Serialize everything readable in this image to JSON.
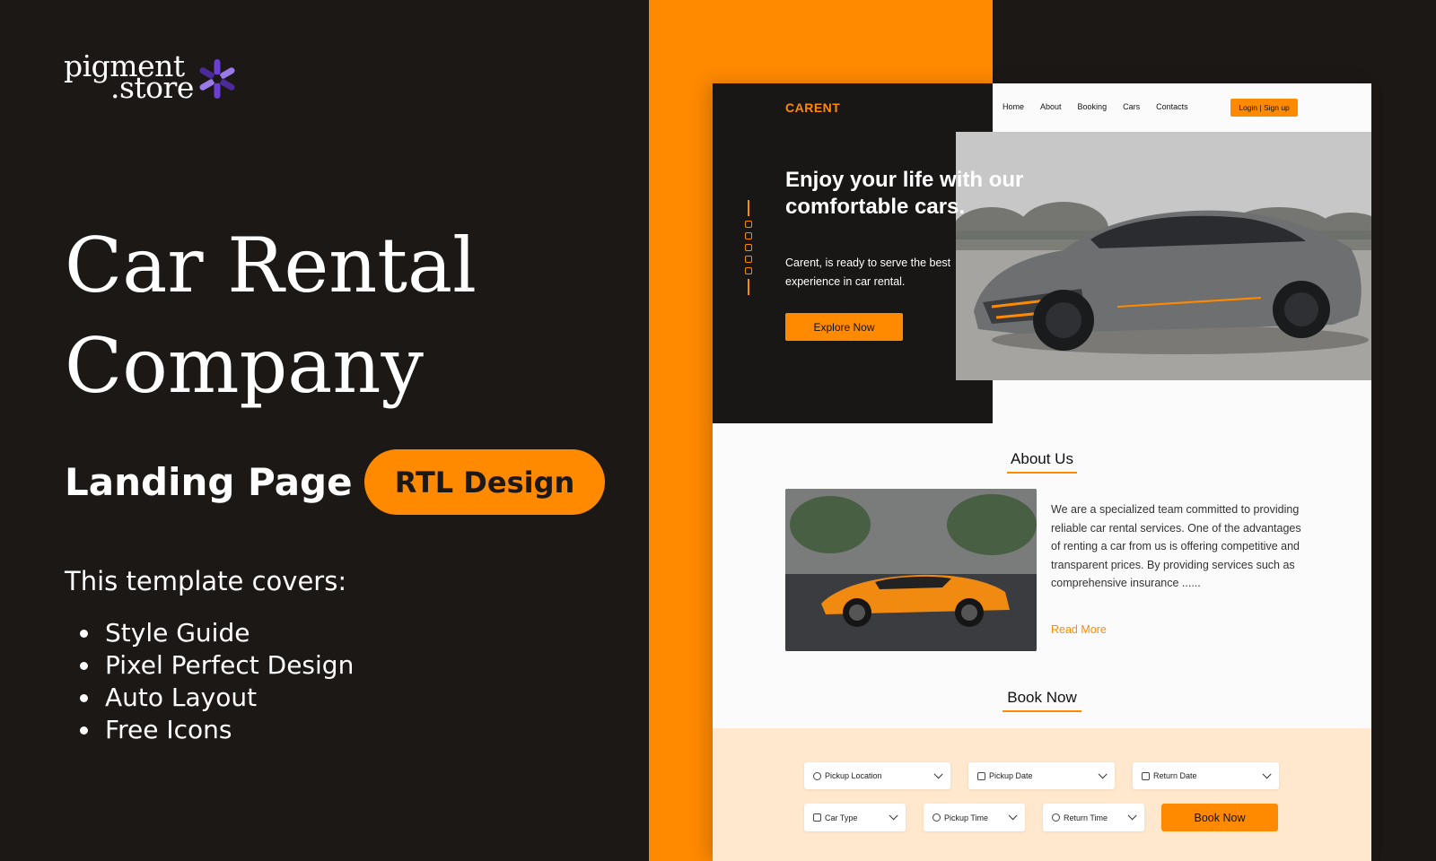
{
  "logo": {
    "line1": "pigment",
    "line2": ".store",
    "colors": [
      "#6a3fd2",
      "#9a7ae6",
      "#4b2a9b"
    ]
  },
  "promo": {
    "title_line1": "Car Rental",
    "title_line2": "Company",
    "subtitle": "Landing Page +",
    "pill": "RTL Design",
    "covers_label": "This template covers:",
    "covers": [
      "Style Guide",
      "Pixel Perfect Design",
      "Auto Layout",
      "Free Icons"
    ]
  },
  "colors": {
    "accent": "#ff8a00",
    "background": "#1c1816",
    "site_dark": "#191716",
    "book_band": "#ffe8cd"
  },
  "site": {
    "brand": "CARENT",
    "nav": [
      "Home",
      "About",
      "Booking",
      "Cars",
      "Contacts"
    ],
    "login": "Login | Sign up",
    "headline": "Enjoy your life with our comfortable cars.",
    "tagline": "Carent, is ready to serve the best experience in car rental.",
    "explore": "Explore Now",
    "social_icons": [
      "facebook-icon",
      "instagram-icon",
      "twitter-icon",
      "whatsapp-icon",
      "telegram-icon"
    ],
    "about": {
      "title": "About Us",
      "text": "We are a specialized team committed to providing reliable car rental services. One of the advantages of renting a car from us is offering competitive and transparent prices. By providing services such as comprehensive insurance ......",
      "read_more": "Read More"
    },
    "booking": {
      "title": "Book Now",
      "pickup_location": "Pickup Location",
      "pickup_date": "Pickup Date",
      "return_date": "Return Date",
      "car_type": "Car Type",
      "pickup_time": "Pickup Time",
      "return_time": "Return Time",
      "button": "Book Now"
    }
  }
}
